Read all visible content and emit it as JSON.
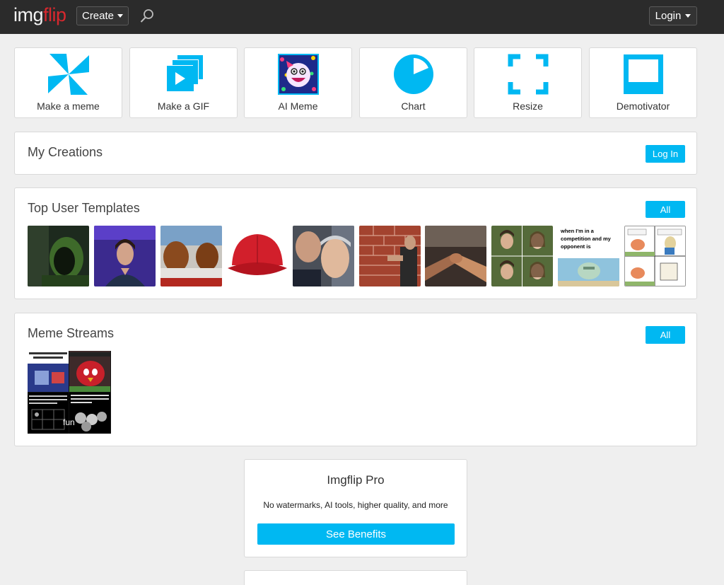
{
  "header": {
    "logo_part1": "img",
    "logo_part2": "flip",
    "create_label": "Create",
    "login_label": "Login"
  },
  "tools": [
    {
      "label": "Make a meme",
      "icon": "pinwheel-icon"
    },
    {
      "label": "Make a GIF",
      "icon": "gif-stack-icon"
    },
    {
      "label": "AI Meme",
      "icon": "ai-face-icon"
    },
    {
      "label": "Chart",
      "icon": "pie-chart-icon"
    },
    {
      "label": "Resize",
      "icon": "resize-corners-icon"
    },
    {
      "label": "Demotivator",
      "icon": "frame-icon"
    }
  ],
  "my_creations": {
    "title": "My Creations",
    "button": "Log In"
  },
  "top_templates": {
    "title": "Top User Templates",
    "button": "All",
    "items": [
      {
        "caption": ""
      },
      {
        "caption": ""
      },
      {
        "caption": ""
      },
      {
        "caption": ""
      },
      {
        "caption": ""
      },
      {
        "caption": ""
      },
      {
        "caption": ""
      },
      {
        "caption": ""
      },
      {
        "caption": "when I'm in a competition and my opponent is"
      },
      {
        "caption": ""
      }
    ]
  },
  "meme_streams": {
    "title": "Meme Streams",
    "button": "All",
    "stream_label": "fun"
  },
  "pro": {
    "title": "Imgflip Pro",
    "desc": "No watermarks, AI tools, higher quality, and more",
    "button": "See Benefits"
  },
  "colors": {
    "accent": "#00b8f2",
    "header_bg": "#2b2b2b",
    "logo_red": "#d8282e"
  }
}
